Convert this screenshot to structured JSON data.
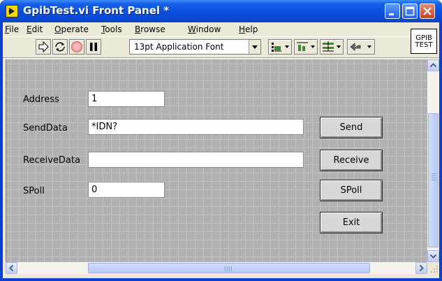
{
  "window": {
    "title": "GpibTest.vi Front Panel *"
  },
  "menu": [
    {
      "key": "F",
      "rest": "ile"
    },
    {
      "key": "E",
      "rest": "dit"
    },
    {
      "key": "O",
      "rest": "perate"
    },
    {
      "key": "T",
      "rest": "ools"
    },
    {
      "key": "B",
      "rest": "rowse"
    },
    {
      "key": "W",
      "rest": "indow"
    },
    {
      "key": "H",
      "rest": "elp"
    }
  ],
  "toolbar": {
    "font_selector": "13pt Application Font",
    "icons": [
      "run-arrow-icon",
      "run-continuously-icon",
      "abort-icon",
      "pause-icon",
      "align-objects-icon",
      "distribute-objects-icon",
      "resize-objects-icon",
      "reorder-icon"
    ]
  },
  "vi_icon": {
    "line1": "GPIB",
    "line2": "TEST"
  },
  "panel": {
    "address_label": "Address",
    "address_value": "1",
    "senddata_label": "SendData",
    "senddata_value": "*IDN?",
    "receivedata_label": "ReceiveData",
    "receivedata_value": "",
    "spoll_label": "SPoll",
    "spoll_value": "0",
    "send_button": "Send",
    "receive_button": "Receive",
    "spoll_button": "SPoll",
    "exit_button": "Exit"
  },
  "colors": {
    "titlebar": "#0a4ad6",
    "panel_background": "#b1b1b1",
    "panel_grid": "#c3c3c3"
  }
}
